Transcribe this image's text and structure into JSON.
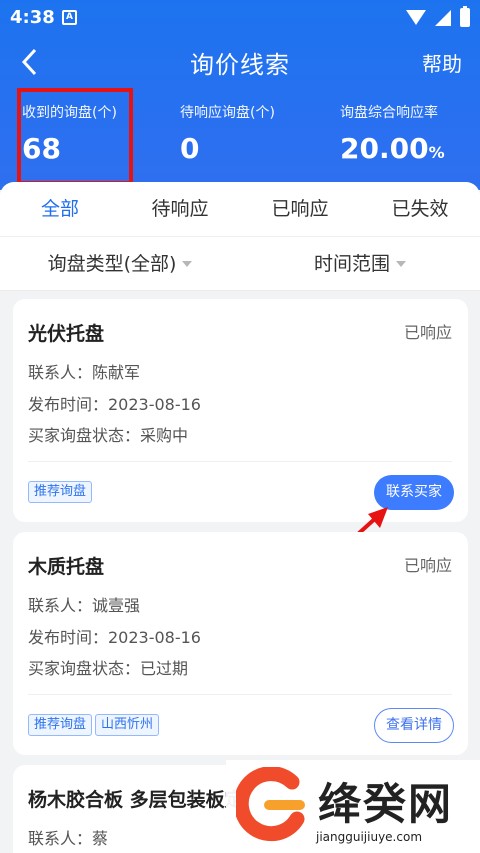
{
  "status_bar": {
    "time": "4:38",
    "notification_icon": "A"
  },
  "nav": {
    "title": "询价线索",
    "help": "帮助"
  },
  "stats": [
    {
      "label": "收到的询盘(个)",
      "value": "68",
      "unit": ""
    },
    {
      "label": "待响应询盘(个)",
      "value": "0",
      "unit": ""
    },
    {
      "label": "询盘综合响应率",
      "value": "20.00",
      "unit": "%"
    }
  ],
  "tabs": [
    "全部",
    "待响应",
    "已响应",
    "已失效"
  ],
  "filters": [
    "询盘类型(全部)",
    "时间范围"
  ],
  "cards": [
    {
      "title": "光伏托盘",
      "status": "已响应",
      "contact": "联系人：陈献军",
      "published": "发布时间：2023-08-16",
      "buyer_status": "买家询盘状态：采购中",
      "tags": [
        "推荐询盘"
      ],
      "button": "联系买家"
    },
    {
      "title": "木质托盘",
      "status": "已响应",
      "contact": "联系人：诚壹强",
      "published": "发布时间：2023-08-16",
      "buyer_status": "买家询盘状态：已过期",
      "tags": [
        "推荐询盘",
        "山西忻州"
      ],
      "button": "查看详情"
    },
    {
      "title": "杨木胶合板 多层包装板定",
      "contact": "联系人：蔡"
    }
  ],
  "watermark": {
    "brand": "绛癸网",
    "site": "jiangguijiuye.com"
  },
  "colors": {
    "header_blue": "#1d73ef",
    "accent": "#3d7bff",
    "highlight_red": "#e71212"
  }
}
